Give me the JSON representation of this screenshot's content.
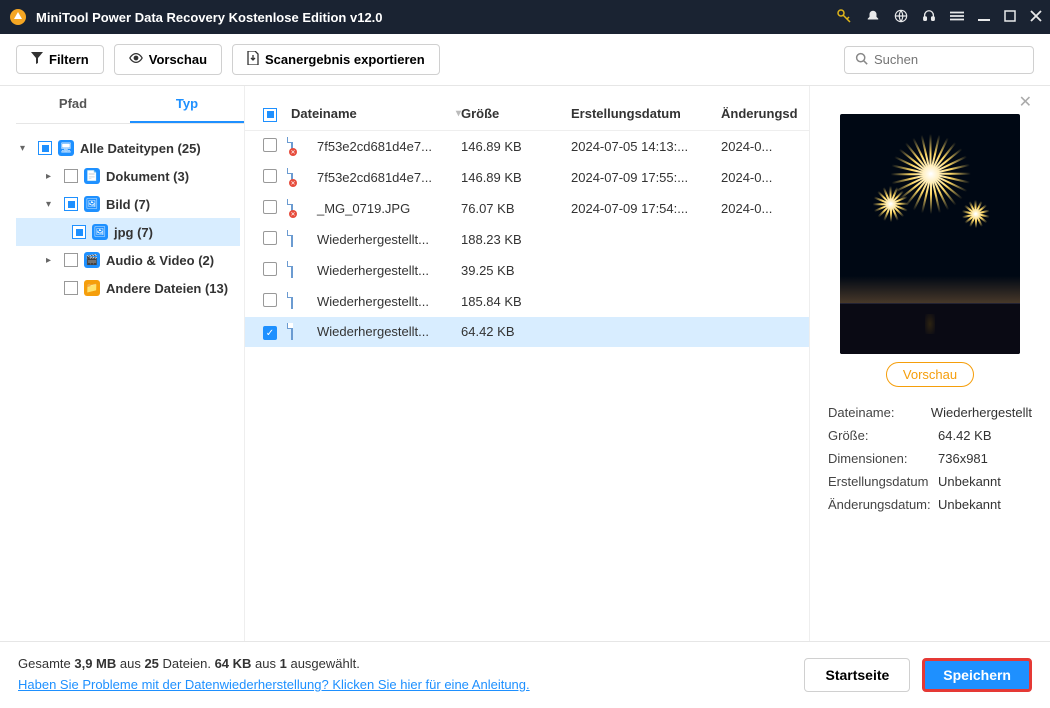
{
  "title": "MiniTool Power Data Recovery Kostenlose Edition v12.0",
  "toolbar": {
    "filter": "Filtern",
    "preview": "Vorschau",
    "export": "Scanergebnis exportieren",
    "search_placeholder": "Suchen"
  },
  "tabs": {
    "path": "Pfad",
    "type": "Typ"
  },
  "tree": {
    "all": "Alle Dateitypen (25)",
    "doc": "Dokument (3)",
    "img": "Bild (7)",
    "jpg": "jpg (7)",
    "av": "Audio & Video (2)",
    "other": "Andere Dateien (13)"
  },
  "columns": {
    "name": "Dateiname",
    "size": "Größe",
    "created": "Erstellungsdatum",
    "modified": "Änderungsd"
  },
  "files": [
    {
      "name": "7f53e2cd681d4e7...",
      "size": "146.89 KB",
      "created": "2024-07-05 14:13:...",
      "modified": "2024-0...",
      "bad": true,
      "checked": false
    },
    {
      "name": "7f53e2cd681d4e7...",
      "size": "146.89 KB",
      "created": "2024-07-09 17:55:...",
      "modified": "2024-0...",
      "bad": true,
      "checked": false
    },
    {
      "name": "_MG_0719.JPG",
      "size": "76.07 KB",
      "created": "2024-07-09 17:54:...",
      "modified": "2024-0...",
      "bad": true,
      "checked": false
    },
    {
      "name": "Wiederhergestellt...",
      "size": "188.23 KB",
      "created": "",
      "modified": "",
      "bad": false,
      "checked": false
    },
    {
      "name": "Wiederhergestellt...",
      "size": "39.25 KB",
      "created": "",
      "modified": "",
      "bad": false,
      "checked": false
    },
    {
      "name": "Wiederhergestellt...",
      "size": "185.84 KB",
      "created": "",
      "modified": "",
      "bad": false,
      "checked": false
    },
    {
      "name": "Wiederhergestellt...",
      "size": "64.42 KB",
      "created": "",
      "modified": "",
      "bad": false,
      "checked": true
    }
  ],
  "preview": {
    "button": "Vorschau",
    "meta": {
      "name_label": "Dateiname:",
      "name_value": "Wiederhergestellt",
      "size_label": "Größe:",
      "size_value": "64.42 KB",
      "dim_label": "Dimensionen:",
      "dim_value": "736x981",
      "created_label": "Erstellungsdatum",
      "created_value": "Unbekannt",
      "modified_label": "Änderungsdatum:",
      "modified_value": "Unbekannt"
    }
  },
  "footer": {
    "status_prefix": "Gesamte ",
    "total_size": "3,9 MB",
    "status_mid1": " aus ",
    "total_files": "25",
    "status_mid2": " Dateien.  ",
    "sel_size": "64 KB",
    "status_mid3": " aus ",
    "sel_count": "1",
    "status_suffix": " ausgewählt.",
    "help_link": "Haben Sie Probleme mit der Datenwiederherstellung? Klicken Sie hier für eine Anleitung.",
    "home": "Startseite",
    "save": "Speichern"
  }
}
